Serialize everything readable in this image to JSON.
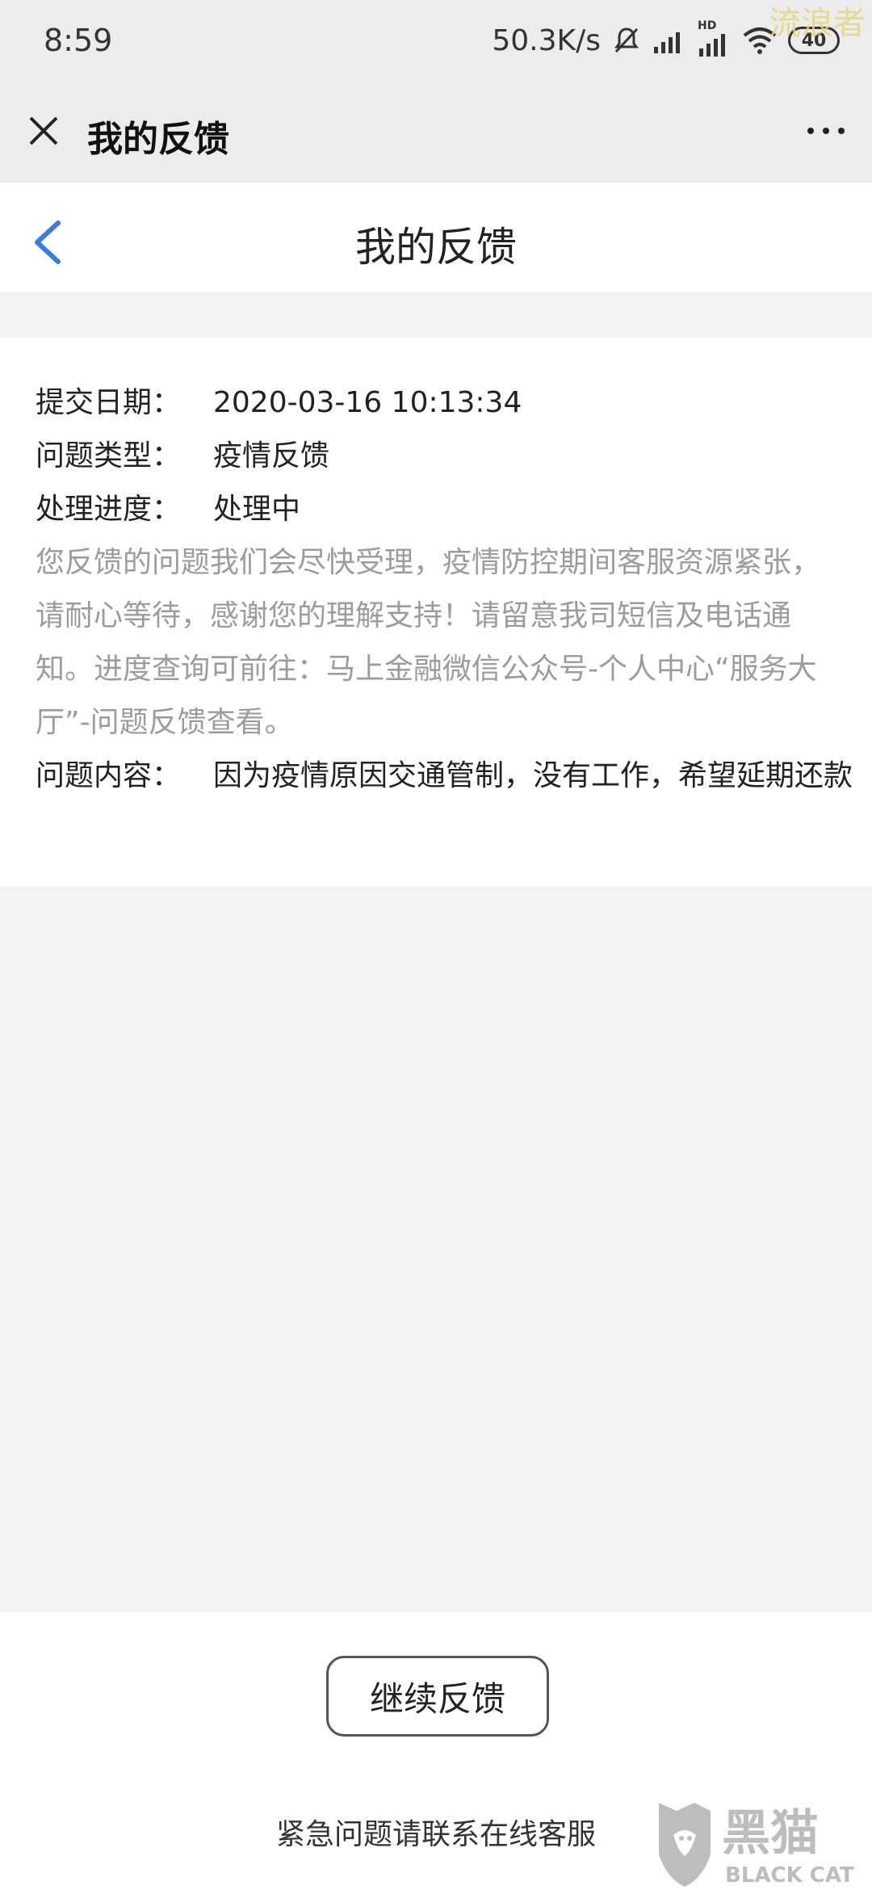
{
  "status_bar": {
    "time": "8:59",
    "net_speed": "50.3K/s",
    "hd_label": "HD",
    "battery": "40",
    "watermark": "流浪者"
  },
  "app_bar": {
    "title": "我的反馈"
  },
  "page_header": {
    "title": "我的反馈"
  },
  "feedback": {
    "date_label": "提交日期：",
    "date_value": "2020-03-16 10:13:34",
    "type_label": "问题类型：",
    "type_value": "疫情反馈",
    "progress_label": "处理进度：",
    "progress_value": "处理中",
    "notice": "您反馈的问题我们会尽快受理，疫情防控期间客服资源紧张，请耐心等待，感谢您的理解支持！请留意我司短信及电话通知。进度查询可前往：马上金融微信公众号-个人中心“服务大厅”-问题反馈查看。",
    "content_label": "问题内容：",
    "content_value": "因为疫情原因交通管制，没有工作，希望延期还款"
  },
  "bottom": {
    "continue_label": "继续反馈",
    "contact_text": "紧急问题请联系在线客服"
  },
  "logo": {
    "text_cn": "黑猫",
    "text_en": "BLACK CAT"
  },
  "colors": {
    "accent": "#3a7be0",
    "notice_gray": "#9c9c9c"
  }
}
